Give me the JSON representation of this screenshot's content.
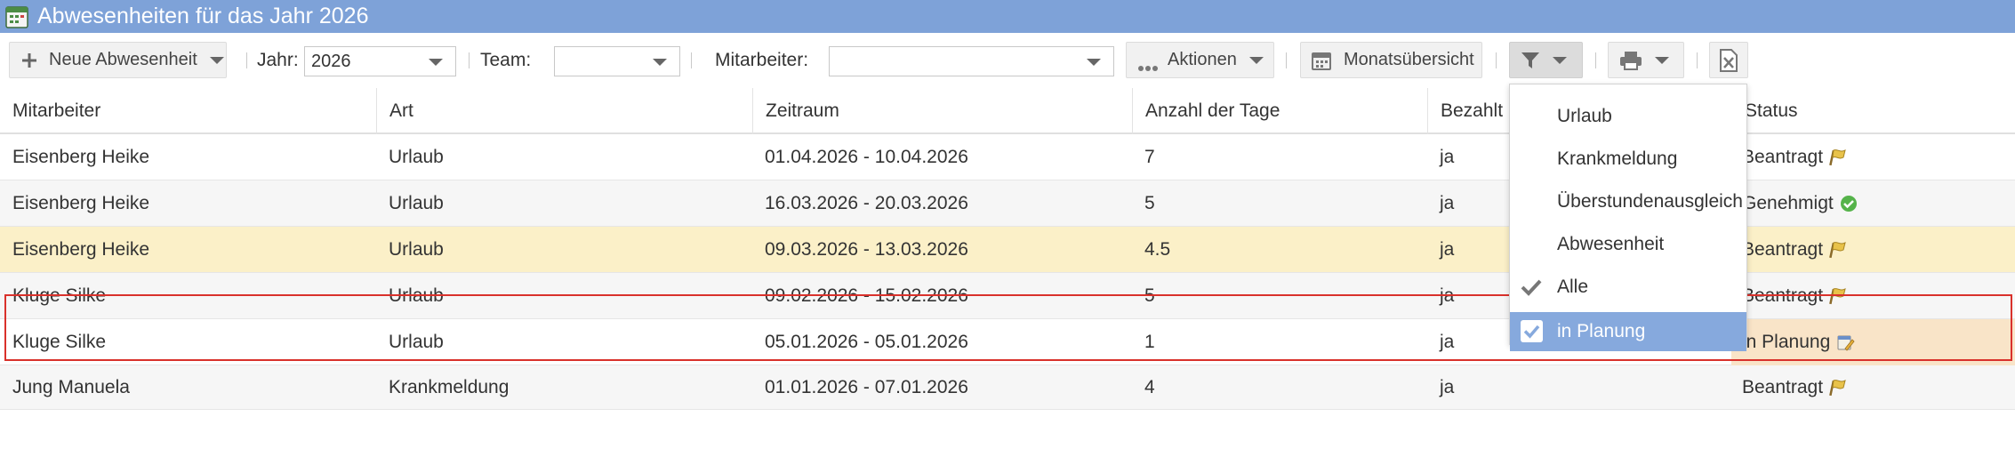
{
  "window": {
    "title": "Abwesenheiten für das Jahr 2026"
  },
  "toolbar": {
    "new_absence_label": "Neue Abwesenheit",
    "year_label": "Jahr:",
    "year_value": "2026",
    "team_label": "Team:",
    "team_value": "",
    "employee_label": "Mitarbeiter:",
    "employee_value": "",
    "actions_label": "Aktionen",
    "month_overview_label": "Monatsübersicht"
  },
  "table": {
    "columns": [
      "Mitarbeiter",
      "Art",
      "Zeitraum",
      "Anzahl der Tage",
      "Bezahlt",
      "Status"
    ],
    "rows": [
      {
        "employee": "Eisenberg Heike",
        "type": "Urlaub",
        "period": "01.04.2026 - 10.04.2026",
        "days": "7",
        "paid": "ja",
        "status": "Beantragt",
        "status_icon": "flag-icon"
      },
      {
        "employee": "Eisenberg Heike",
        "type": "Urlaub",
        "period": "16.03.2026 - 20.03.2026",
        "days": "5",
        "paid": "ja",
        "status": "Genehmigt",
        "status_icon": "check-circle-icon"
      },
      {
        "employee": "Eisenberg Heike",
        "type": "Urlaub",
        "period": "09.03.2026 - 13.03.2026",
        "days": "4.5",
        "paid": "ja",
        "status": "Beantragt",
        "status_icon": "flag-icon"
      },
      {
        "employee": "Kluge Silke",
        "type": "Urlaub",
        "period": "09.02.2026 - 15.02.2026",
        "days": "5",
        "paid": "ja",
        "status": "Beantragt",
        "status_icon": "flag-icon"
      },
      {
        "employee": "Kluge Silke",
        "type": "Urlaub",
        "period": "05.01.2026 - 05.01.2026",
        "days": "1",
        "paid": "ja",
        "status": "in Planung",
        "status_icon": "planning-note-icon"
      },
      {
        "employee": "Jung Manuela",
        "type": "Krankmeldung",
        "period": "01.01.2026 - 07.01.2026",
        "days": "4",
        "paid": "ja",
        "status": "Beantragt",
        "status_icon": "flag-icon"
      }
    ]
  },
  "filter_menu": {
    "items": [
      {
        "label": "Urlaub",
        "state": "none"
      },
      {
        "label": "Krankmeldung",
        "state": "none"
      },
      {
        "label": "Überstundenausgleich",
        "state": "none"
      },
      {
        "label": "Abwesenheit",
        "state": "none"
      },
      {
        "label": "Alle",
        "state": "checked"
      },
      {
        "label": "in Planung",
        "state": "checkbox-active"
      }
    ]
  },
  "colors": {
    "titlebar": "#7ea2d8",
    "selected_row": "#fbf0c8",
    "planning_status": "#f9e4c8",
    "highlight_border": "#d9312b",
    "menu_active": "#86a9dd"
  }
}
